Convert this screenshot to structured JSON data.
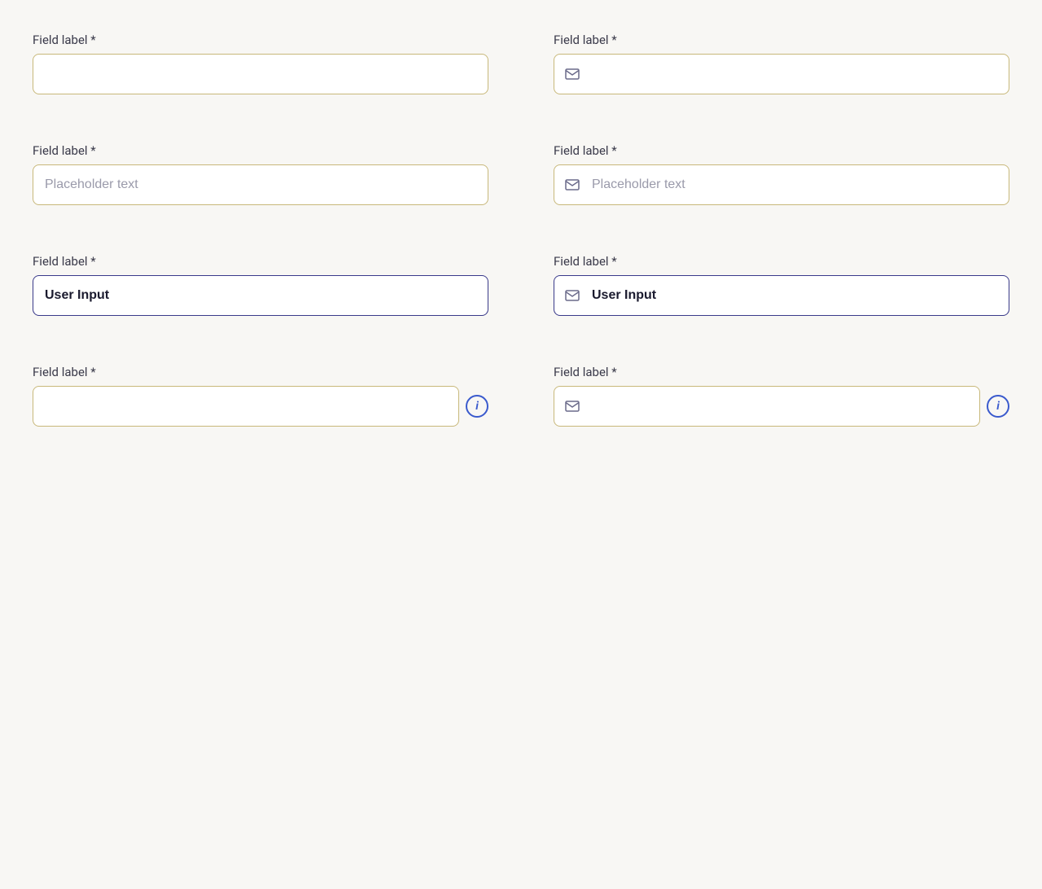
{
  "fields": {
    "row1": {
      "left": {
        "label": "Field label *",
        "placeholder": "",
        "value": "",
        "hasIcon": false,
        "hasInfo": false,
        "id": "field-1-left"
      },
      "right": {
        "label": "Field label *",
        "placeholder": "",
        "value": "",
        "hasIcon": true,
        "hasInfo": false,
        "id": "field-1-right"
      }
    },
    "row2": {
      "left": {
        "label": "Field label *",
        "placeholder": "Placeholder text",
        "value": "",
        "hasIcon": false,
        "hasInfo": false,
        "id": "field-2-left"
      },
      "right": {
        "label": "Field label *",
        "placeholder": "Placeholder text",
        "value": "",
        "hasIcon": true,
        "hasInfo": false,
        "id": "field-2-right"
      }
    },
    "row3": {
      "left": {
        "label": "Field label *",
        "placeholder": "",
        "value": "User Input",
        "hasIcon": false,
        "hasInfo": false,
        "id": "field-3-left"
      },
      "right": {
        "label": "Field label *",
        "placeholder": "",
        "value": "User Input",
        "hasIcon": true,
        "hasInfo": false,
        "id": "field-3-right"
      }
    },
    "row4": {
      "left": {
        "label": "Field label *",
        "placeholder": "",
        "value": "",
        "hasIcon": false,
        "hasInfo": true,
        "id": "field-4-left"
      },
      "right": {
        "label": "Field label *",
        "placeholder": "",
        "value": "",
        "hasIcon": true,
        "hasInfo": true,
        "id": "field-4-right"
      }
    }
  },
  "icons": {
    "email": "✉",
    "info": "i"
  }
}
